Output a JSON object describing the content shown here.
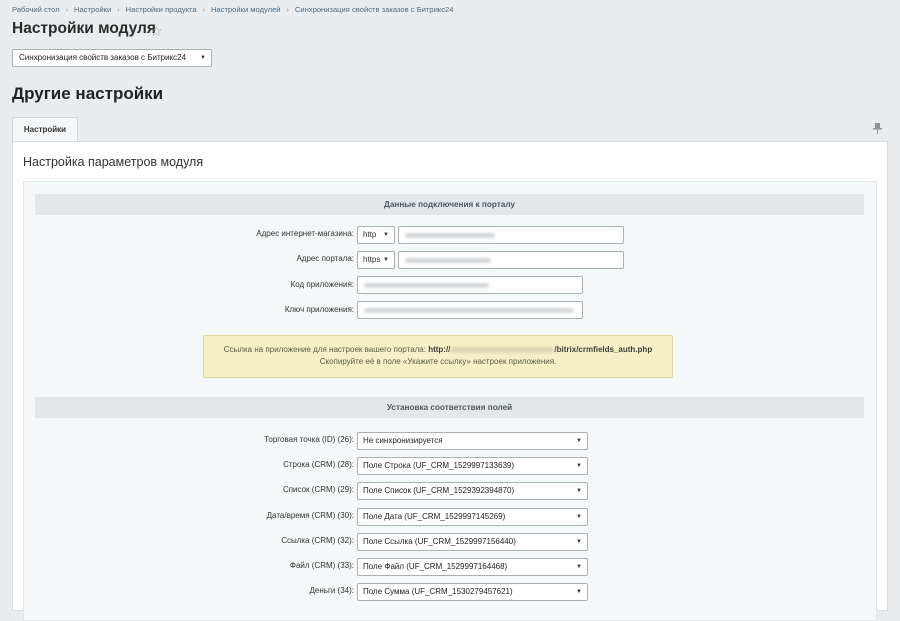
{
  "breadcrumb": [
    "Рабочий стол",
    "Настройки",
    "Настройки продукта",
    "Настройки модулей",
    "Синхронизация свойств заказов с Битрикс24"
  ],
  "page_title": "Настройки модуля",
  "module_select": {
    "value": "Синхронизация свойств заказов с Битрикс24"
  },
  "section_title": "Другие настройки",
  "tab_label": "Настройки",
  "panel_title": "Настройка параметров модуля",
  "connection": {
    "heading": "Данные подключения к порталу",
    "shop_address": {
      "label": "Адрес интернет-магазина:",
      "protocol": "http"
    },
    "portal_address": {
      "label": "Адрес портала:",
      "protocol": "https"
    },
    "app_code": {
      "label": "Код приложения:"
    },
    "app_key": {
      "label": "Ключ приложения:"
    }
  },
  "notice": {
    "line1_prefix": "Ссылка на приложение для настроек вашего портала:",
    "link_prefix": "http://",
    "link_suffix": "/bitrix/crmfields_auth.php",
    "line2": "Скопируйте её в поле «Укажите ссылку» настроек приложения."
  },
  "mapping": {
    "heading": "Установка соответствия полей",
    "rows": [
      {
        "label": "Торговая точка (ID) (26):",
        "value": "Не синхронизируется"
      },
      {
        "label": "Строка (CRM) (28):",
        "value": "Поле Строка (UF_CRM_1529997133639)"
      },
      {
        "label": "Список (CRM) (29):",
        "value": "Поле Список (UF_CRM_1529392394870)"
      },
      {
        "label": "Дата/время (CRM) (30):",
        "value": "Поле Дата (UF_CRM_1529997145269)"
      },
      {
        "label": "Ссылка (CRM) (32):",
        "value": "Поле Ссылка (UF_CRM_1529997156440)"
      },
      {
        "label": "Файл (CRM) (33):",
        "value": "Поле Файл (UF_CRM_1529997164468)"
      },
      {
        "label": "Деньги (34):",
        "value": "Поле Сумма (UF_CRM_1530279457621)"
      }
    ]
  }
}
